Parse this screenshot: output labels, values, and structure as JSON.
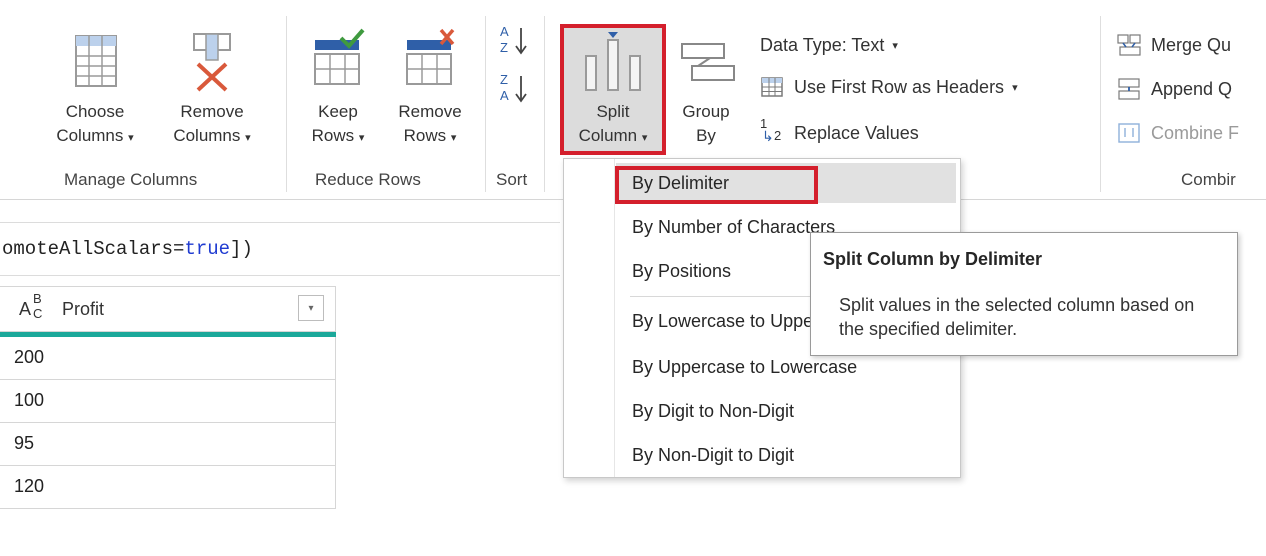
{
  "ribbon": {
    "groups": {
      "manage_columns": {
        "label": "Manage Columns",
        "choose_columns": {
          "line1": "Choose",
          "line2": "Columns"
        },
        "remove_columns": {
          "line1": "Remove",
          "line2": "Columns"
        }
      },
      "reduce_rows": {
        "label": "Reduce Rows",
        "keep_rows": {
          "line1": "Keep",
          "line2": "Rows"
        },
        "remove_rows": {
          "line1": "Remove",
          "line2": "Rows"
        }
      },
      "sort": {
        "label": "Sort",
        "ascending_icon_top": "A",
        "ascending_icon_bottom": "Z",
        "descending_icon_top": "Z",
        "descending_icon_bottom": "A"
      },
      "transform": {
        "split_column": {
          "line1": "Split",
          "line2": "Column"
        },
        "group_by": {
          "line1": "Group",
          "line2": "By"
        },
        "data_type": "Data Type: Text",
        "first_row_headers": "Use First Row as Headers",
        "replace_values": "Replace Values",
        "replace_icon_top": "1",
        "replace_icon_bottom": "2"
      },
      "combine": {
        "label": "Combir",
        "merge": "Merge Qu",
        "append": "Append Q",
        "combine_files": "Combine F"
      }
    },
    "caret_glyph": "▾"
  },
  "formula_bar": {
    "text_prefix": "omoteAllScalars=",
    "keyword": "true",
    "text_suffix": "])"
  },
  "grid": {
    "column": {
      "type_icon": "ABC",
      "name": "Profit",
      "filter_glyph": "▾"
    },
    "rows": [
      "200",
      "100",
      "95",
      "120"
    ]
  },
  "split_menu": {
    "items": [
      "By Delimiter",
      "By Number of Characters",
      "By Positions",
      "By Lowercase to Uppercase",
      "By Uppercase to Lowercase",
      "By Digit to Non-Digit",
      "By Non-Digit to Digit"
    ]
  },
  "tooltip": {
    "title": "Split Column by Delimiter",
    "body": "Split values in the selected column based on the specified delimiter."
  },
  "colors": {
    "highlight_red": "#d41f2c",
    "column_accent": "#1ba89a",
    "icon_blue": "#2f5fa8",
    "check_green": "#3f9a3f",
    "remove_red": "#d9593b"
  }
}
